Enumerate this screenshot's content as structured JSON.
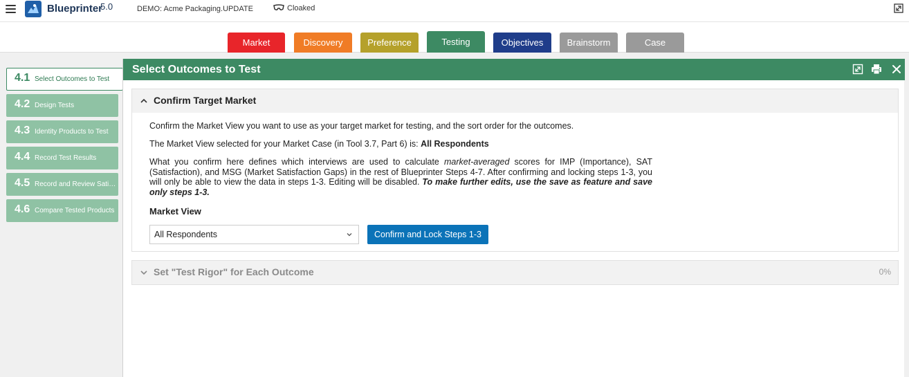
{
  "app": {
    "name": "Blueprinter",
    "version": "5.0",
    "demo": "DEMO: Acme Packaging.UPDATE",
    "cloak_label": "Cloaked"
  },
  "tabs": [
    {
      "label": "Market",
      "color": "#e8252a"
    },
    {
      "label": "Discovery",
      "color": "#f07c26"
    },
    {
      "label": "Preference",
      "color": "#b5a12b"
    },
    {
      "label": "Testing",
      "color": "#3d8a63"
    },
    {
      "label": "Objectives",
      "color": "#1f3d8a"
    },
    {
      "label": "Brainstorm",
      "color": "#9a9a9a"
    },
    {
      "label": "Case",
      "color": "#9a9a9a"
    }
  ],
  "active_tab": "Testing",
  "sidebar": {
    "items": [
      {
        "num": "4.1",
        "label": "Select Outcomes to Test"
      },
      {
        "num": "4.2",
        "label": "Design Tests"
      },
      {
        "num": "4.3",
        "label": "Identity Products to Test"
      },
      {
        "num": "4.4",
        "label": "Record Test Results"
      },
      {
        "num": "4.5",
        "label": "Record and Review Satis..."
      },
      {
        "num": "4.6",
        "label": "Compare Tested Products"
      }
    ]
  },
  "panel": {
    "title": "Select Outcomes to Test",
    "section1": {
      "title": "Confirm Target Market",
      "para1": "Confirm the Market View you want to use as your target market for testing, and the sort order for the outcomes.",
      "para2_prefix": "The Market View selected for your Market Case (in Tool 3.7, Part 6) is: ",
      "para2_value": "All Respondents",
      "para3_part1": "What you confirm here defines which interviews are used to calculate ",
      "para3_italic": "market-averaged",
      "para3_part2": " scores for IMP (Importance), SAT (Satisfaction), and MSG (Market Satisfaction Gaps) in the rest of Blueprinter Steps 4-7. After confirming and locking steps 1-3, you will only be able to view the data in steps 1-3. Editing will be disabled. ",
      "para3_bold_italic": "To make further edits, use the save as feature and save only steps 1-3.",
      "market_view_label": "Market View",
      "market_view_value": "All Respondents",
      "confirm_button": "Confirm and Lock Steps 1-3"
    },
    "section2": {
      "title": "Set \"Test Rigor\" for Each Outcome",
      "percent": "0%"
    }
  }
}
